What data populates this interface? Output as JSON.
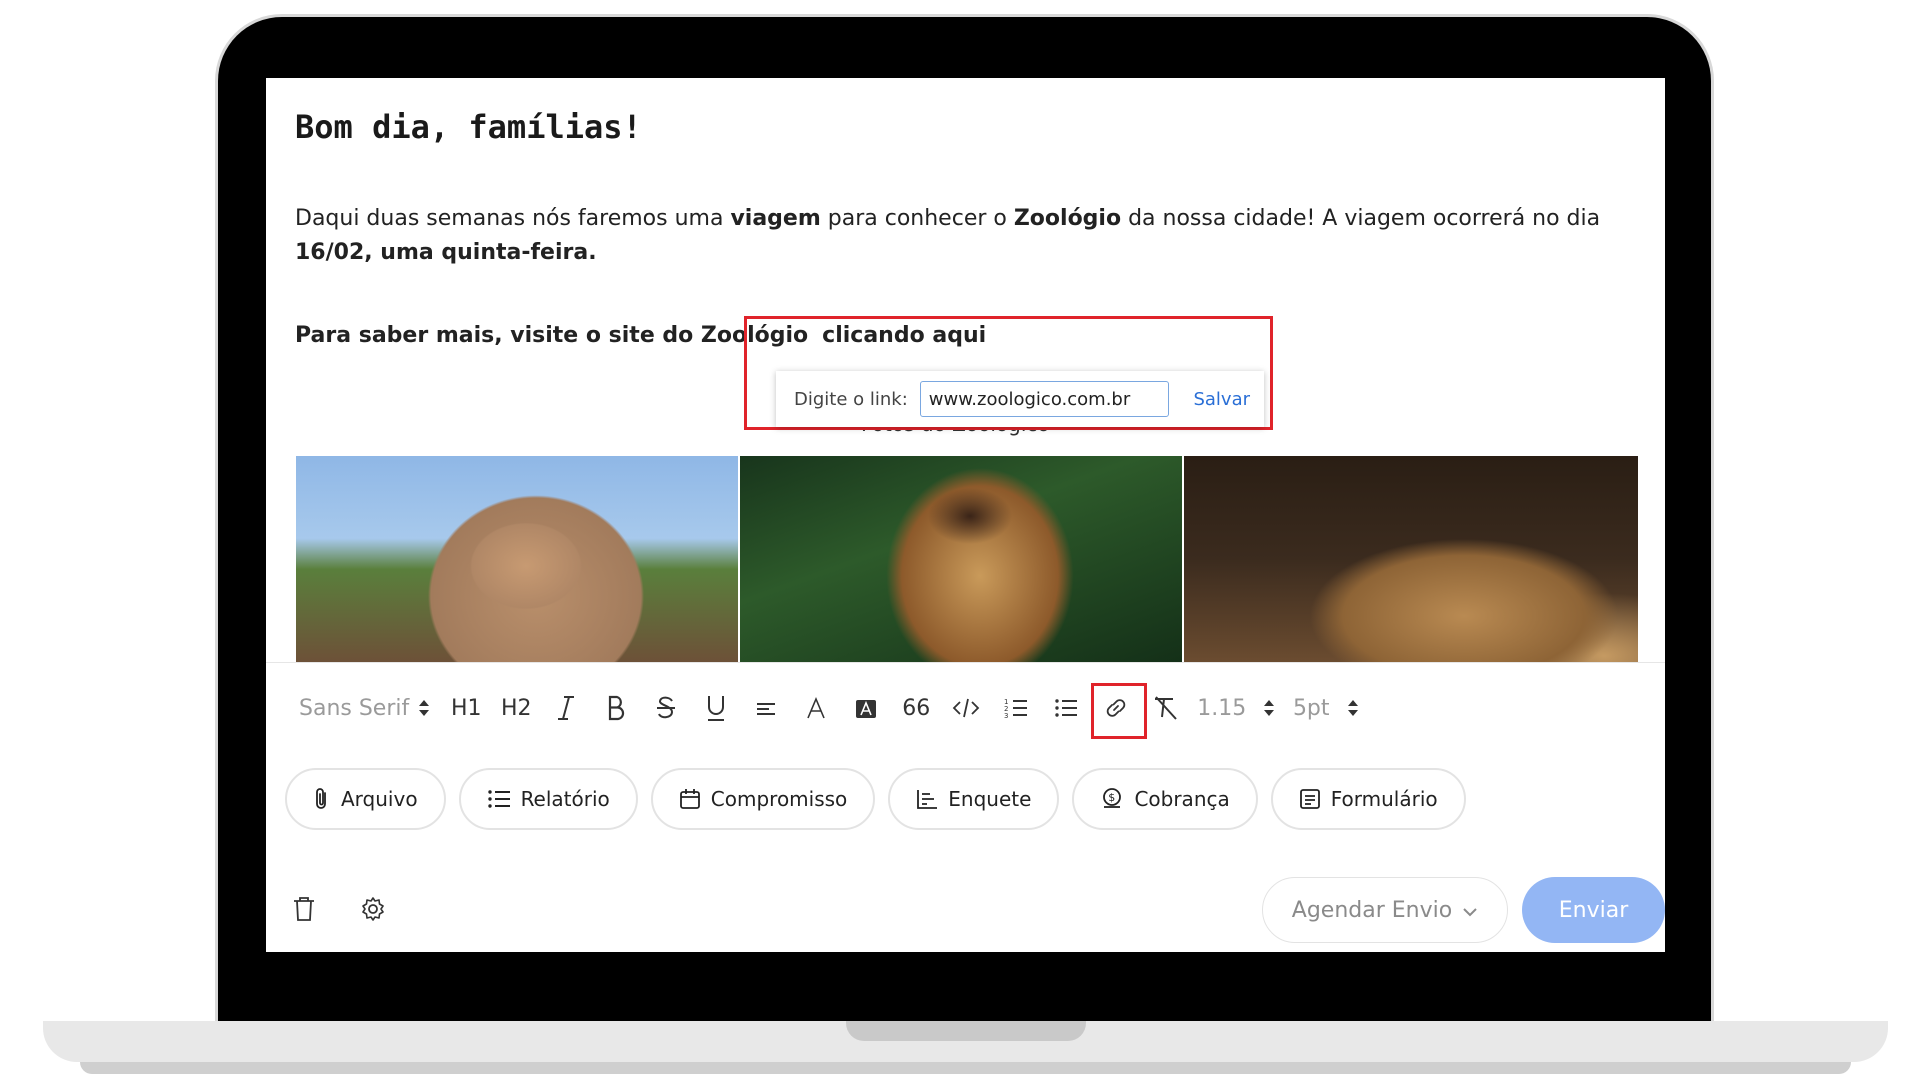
{
  "editor": {
    "greeting": "Bom dia, famílias!",
    "paragraph": {
      "t1": "Daqui duas semanas nós faremos uma ",
      "b1": "viagem",
      "t2": " para conhecer o ",
      "b2": "Zoológio",
      "t3": " da nossa cidade! A viagem ocorrerá no dia ",
      "b3": "16/02, uma quinta-feira."
    },
    "link_line": {
      "text": "Para saber mais, visite o site do Zoológio",
      "anchor": "clicando aqui"
    },
    "link_popup": {
      "label": "Digite o link:",
      "value": "www.zoologico.com.br",
      "save_label": "Salvar"
    },
    "photos_caption": "Fotos do Zoológico"
  },
  "toolbar": {
    "font": "Sans Serif",
    "h1": "H1",
    "h2": "H2",
    "italic": "I",
    "bold": "B",
    "strike": "S",
    "underline": "U",
    "quote": "66",
    "line_height": "1.15",
    "spacing": "5pt"
  },
  "chips": {
    "file": "Arquivo",
    "report": "Relatório",
    "appointment": "Compromisso",
    "poll": "Enquete",
    "charge": "Cobrança",
    "form": "Formulário"
  },
  "footer": {
    "schedule": "Agendar Envio",
    "send": "Enviar"
  },
  "colors": {
    "highlight": "#e0232a",
    "send_button": "#93b6f4",
    "link_save": "#2a6fd6"
  }
}
